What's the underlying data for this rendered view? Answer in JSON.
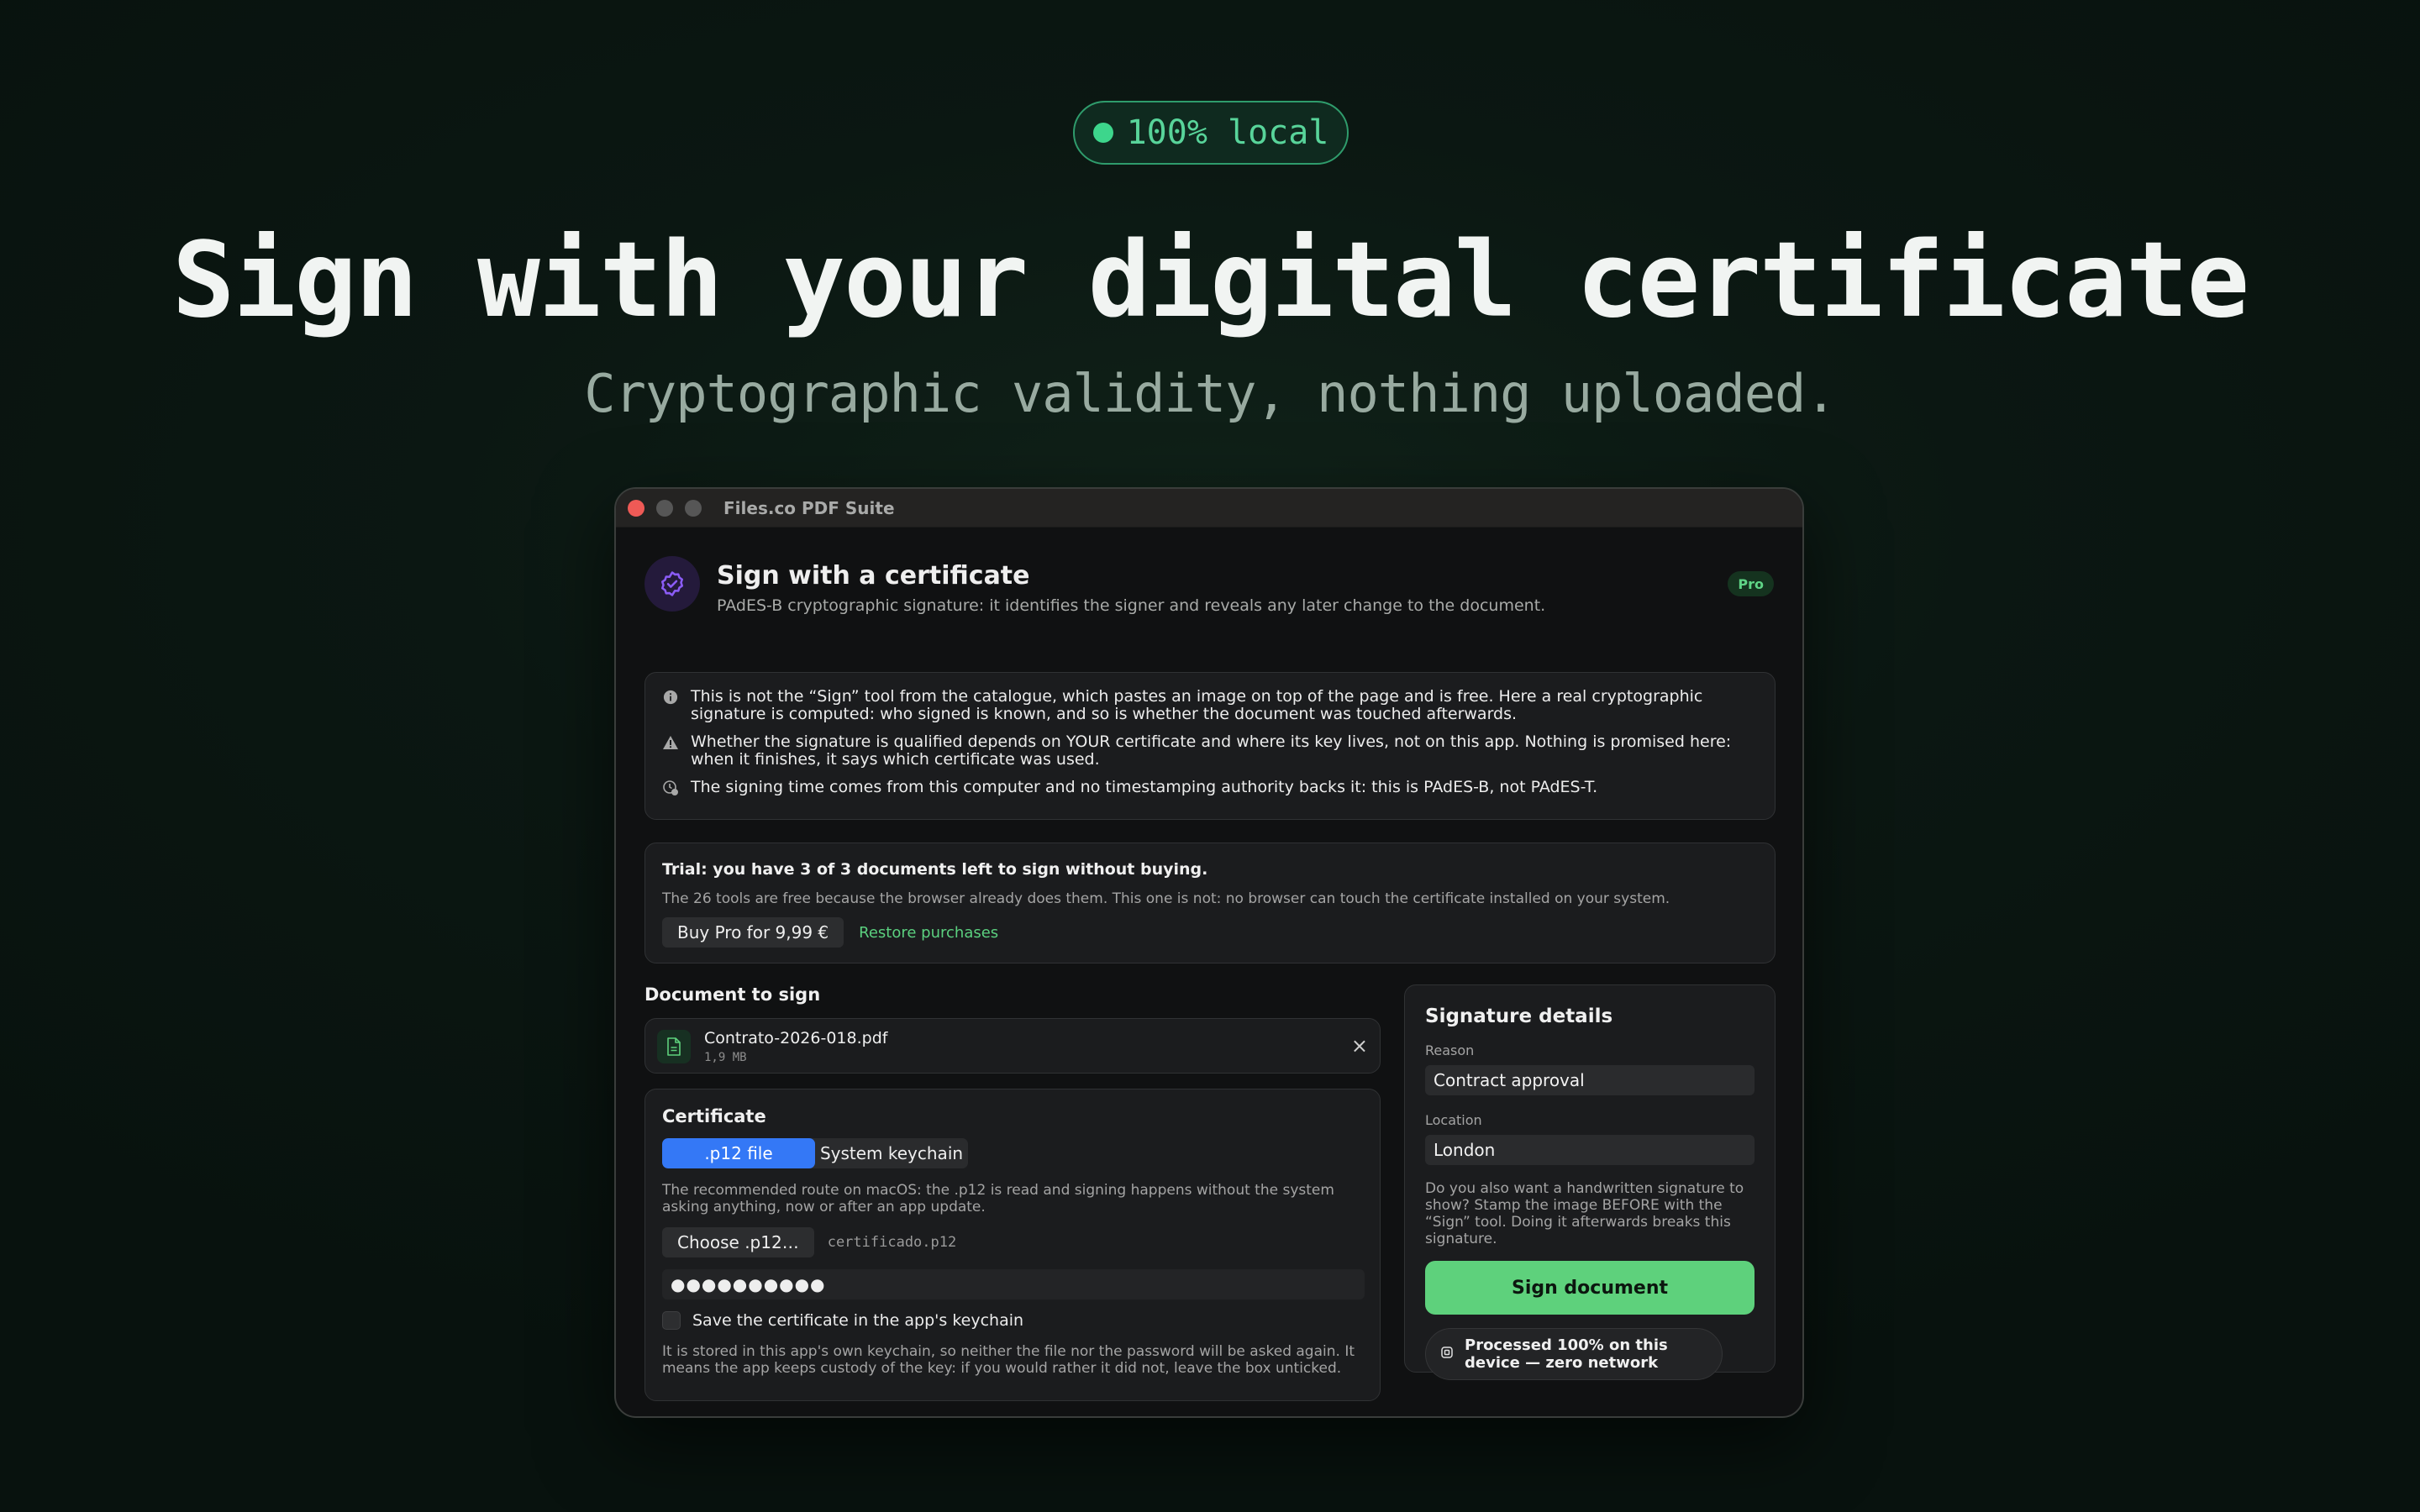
{
  "hero": {
    "badge": "100% local",
    "title": "Sign with your digital certificate",
    "subtitle": "Cryptographic validity, nothing uploaded."
  },
  "window": {
    "title": "Files.co PDF Suite"
  },
  "header": {
    "title": "Sign with a certificate",
    "description": "PAdES-B cryptographic signature: it identifies the signer and reveals any later change to the document.",
    "badge": "Pro"
  },
  "notes": [
    {
      "icon": "info-icon",
      "text": "This is not the “Sign” tool from the catalogue, which pastes an image on top of the page and is free. Here a real cryptographic signature is computed: who signed is known, and so is whether the document was touched afterwards."
    },
    {
      "icon": "warning-icon",
      "text": "Whether the signature is qualified depends on YOUR certificate and where its key lives, not on this app. Nothing is promised here: when it finishes, it says which certificate was used."
    },
    {
      "icon": "clock-icon",
      "text": "The signing time comes from this computer and no timestamping authority backs it: this is PAdES-B, not PAdES-T."
    }
  ],
  "trial": {
    "heading": "Trial: you have 3 of 3 documents left to sign without buying.",
    "subtext": "The 26 tools are free because the browser already does them. This one is not: no browser can touch the certificate installed on your system.",
    "buy_label": "Buy Pro for 9,99 €",
    "restore_label": "Restore purchases"
  },
  "document": {
    "label": "Document to sign",
    "file_name": "Contrato-2026-018.pdf",
    "file_size": "1,9 MB"
  },
  "certificate": {
    "heading": "Certificate",
    "tab_p12": ".p12 file",
    "tab_keychain": "System keychain",
    "description": "The recommended route on macOS: the .p12 is read and signing happens without the system asking anything, now or after an app update.",
    "choose_label": "Choose .p12…",
    "chosen_file": "certificado.p12",
    "password_mask": "●●●●●●●●●●",
    "save_label": "Save the certificate in the app's keychain",
    "footnote": "It is stored in this app's own keychain, so neither the file nor the password will be asked again. It means the app keeps custody of the key: if you would rather it did not, leave the box unticked."
  },
  "details": {
    "heading": "Signature details",
    "reason_label": "Reason",
    "reason_value": "Contract approval",
    "location_label": "Location",
    "location_value": "London",
    "handwritten_note": "Do you also want a handwritten signature to show? Stamp the image BEFORE with the “Sign” tool. Doing it afterwards breaks this signature.",
    "sign_label": "Sign document",
    "local_note": "Processed 100% on this device — zero network"
  },
  "colors": {
    "accent_green": "#5ed17c",
    "accent_blue": "#3478f6",
    "badge_green": "#3dd68c"
  }
}
